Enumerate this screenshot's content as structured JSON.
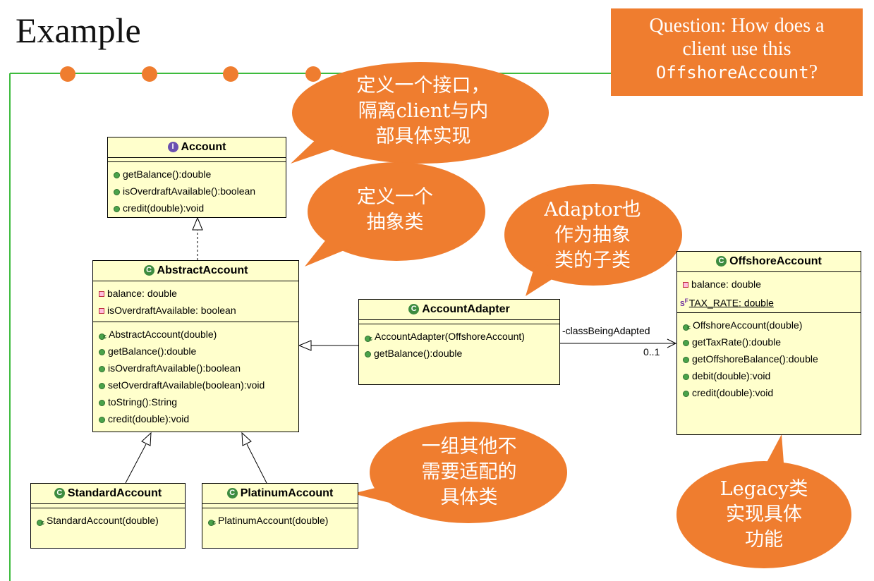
{
  "slide": {
    "title": "Example",
    "question_line1": "Question: How does a",
    "question_line2": "client use this",
    "question_code": "OffshoreAccount",
    "question_end": "?"
  },
  "bubbles": {
    "interface_l1": "定义一个接口，",
    "interface_l2": "隔离client与内",
    "interface_l3": "部具体实现",
    "abstract_l1": "定义一个",
    "abstract_l2": "抽象类",
    "adaptor_l1": "Adaptor也",
    "adaptor_l2": "作为抽象",
    "adaptor_l3": "类的子类",
    "concrete_l1": "一组其他不",
    "concrete_l2": "需要适配的",
    "concrete_l3": "具体类",
    "legacy_l1": "Legacy类",
    "legacy_l2": "实现具体",
    "legacy_l3": "功能"
  },
  "classes": {
    "account": {
      "icon": "I",
      "name": "Account",
      "methods": [
        "getBalance():double",
        "isOverdraftAvailable():boolean",
        "credit(double):void"
      ]
    },
    "abstract_account": {
      "icon": "C",
      "name": "AbstractAccount",
      "fields": [
        "balance: double",
        "isOverdraftAvailable: boolean"
      ],
      "ctor": "AbstractAccount(double)",
      "methods": [
        "getBalance():double",
        "isOverdraftAvailable():boolean",
        "setOverdraftAvailable(boolean):void",
        "toString():String",
        "credit(double):void"
      ]
    },
    "account_adapter": {
      "icon": "C",
      "name": "AccountAdapter",
      "ctor": "AccountAdapter(OffshoreAccount)",
      "methods": [
        "getBalance():double"
      ]
    },
    "offshore_account": {
      "icon": "C",
      "name": "OffshoreAccount",
      "fields": [
        "balance: double"
      ],
      "static_field": "TAX_RATE: double",
      "static_marker": "S",
      "final_marker": "F",
      "ctor": "OffshoreAccount(double)",
      "methods": [
        "getTaxRate():double",
        "getOffshoreBalance():double",
        "debit(double):void",
        "credit(double):void"
      ]
    },
    "standard_account": {
      "icon": "C",
      "name": "StandardAccount",
      "ctor": "StandardAccount(double)"
    },
    "platinum_account": {
      "icon": "C",
      "name": "PlatinumAccount",
      "ctor": "PlatinumAccount(double)"
    },
    "ctor_marker": "c"
  },
  "association": {
    "role": "-classBeingAdapted",
    "multiplicity": "0..1"
  },
  "colors": {
    "accent_orange": "#ef7d2f",
    "timeline_green": "#3dbb3d",
    "class_fill": "#ffffcc"
  }
}
